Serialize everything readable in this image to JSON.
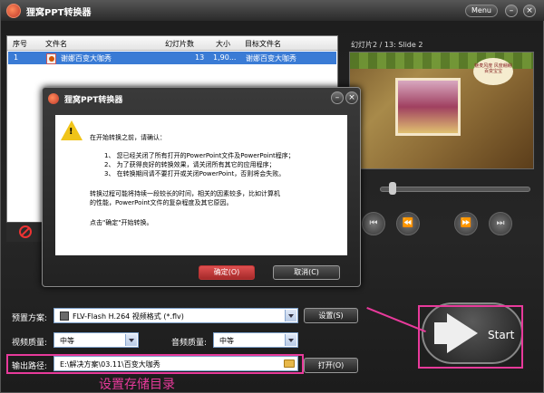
{
  "app": {
    "title": "狸窝PPT转换器",
    "menu_label": "Menu"
  },
  "filelist": {
    "columns": [
      "序号",
      "文件名",
      "幻灯片数",
      "大小",
      "目标文件名"
    ],
    "rows": [
      {
        "index": "1",
        "name": "谢娜百变大咖秀",
        "slides": "13",
        "size": "1,90...",
        "target": "谢娜百变大咖秀"
      }
    ]
  },
  "preview": {
    "label": "幻灯片2 / 13: Slide 2",
    "bubble_text": "魅麦风度 风度翩翩 百变宝宝"
  },
  "dialog": {
    "title": "狸窝PPT转换器",
    "lines": [
      "在开始转换之前，请确认：",
      "1、 您已经关闭了所有打开的PowerPoint文件及PowerPoint程序；",
      "2、 为了获得良好的转换效果，请关闭所有其它的应用程序；",
      "3、 在转换期间请不要打开或关闭PowerPoint，否则将会失败。",
      "转换过程可能将持续一段较长的时间，相关的因素较多，比如计算机",
      "的性能，PowerPoint文件的复杂程度及其它原因。",
      "点击\"确定\"开始转换。"
    ],
    "ok_label": "确定(O)",
    "cancel_label": "取消(C)"
  },
  "settings": {
    "preset_label": "预置方案:",
    "preset_value": "FLV-Flash H.264 视频格式 (*.flv)",
    "settings_btn": "设置(S)",
    "video_quality_label": "视频质量:",
    "video_quality_value": "中等",
    "audio_quality_label": "音频质量:",
    "audio_quality_value": "中等",
    "output_label": "输出路径:",
    "output_value": "E:\\解决方案\\03.11\\百变大咖秀",
    "open_btn": "打开(O)"
  },
  "start_label": "Start",
  "caption": "设置存储目录",
  "colors": {
    "highlight": "#e83a9b",
    "selection": "#3a7bd5",
    "warning": "#f0c419"
  }
}
